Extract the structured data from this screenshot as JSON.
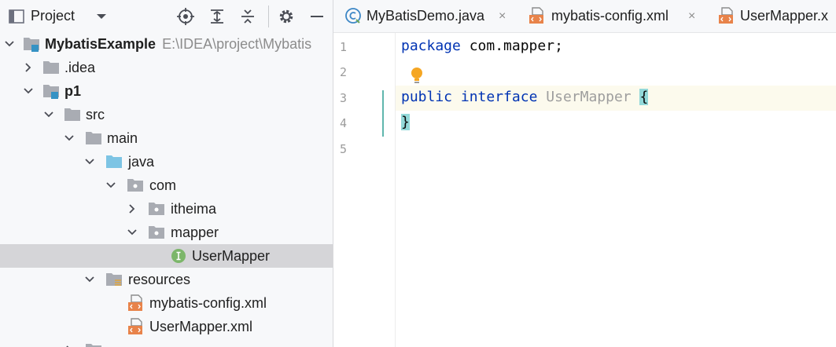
{
  "project_panel": {
    "title": "Project",
    "tree": [
      {
        "label": "MybatisExample",
        "path": "E:\\IDEA\\project\\Mybatis",
        "bold": true
      },
      {
        "label": ".idea"
      },
      {
        "label": "p1",
        "bold": true
      },
      {
        "label": "src"
      },
      {
        "label": "main"
      },
      {
        "label": "java"
      },
      {
        "label": "com"
      },
      {
        "label": "itheima"
      },
      {
        "label": "mapper"
      },
      {
        "label": "UserMapper",
        "selected": true
      },
      {
        "label": "resources"
      },
      {
        "label": "mybatis-config.xml"
      },
      {
        "label": "UserMapper.xml"
      }
    ]
  },
  "tabs": [
    {
      "label": "MyBatisDemo.java",
      "close": "×"
    },
    {
      "label": "mybatis-config.xml",
      "close": "×"
    },
    {
      "label": "UserMapper.x"
    }
  ],
  "editor": {
    "line_numbers": [
      "1",
      "2",
      "3",
      "4",
      "5"
    ],
    "code": {
      "line1_kw": "package",
      "line1_rest": " com.mapper;",
      "line3_kw1": "public",
      "line3_kw2": "interface",
      "line3_name": "UserMapper",
      "line3_brace": "{",
      "line4_brace": "}"
    }
  },
  "colors": {
    "accent": "#3574f0",
    "keyword": "#0033b3",
    "interface_badge": "#7cb66a",
    "xml_icon": "#e8834a",
    "folder": "#a9acb3",
    "source_folder": "#7dc4e4",
    "brace_highlight": "#93d9d9"
  }
}
